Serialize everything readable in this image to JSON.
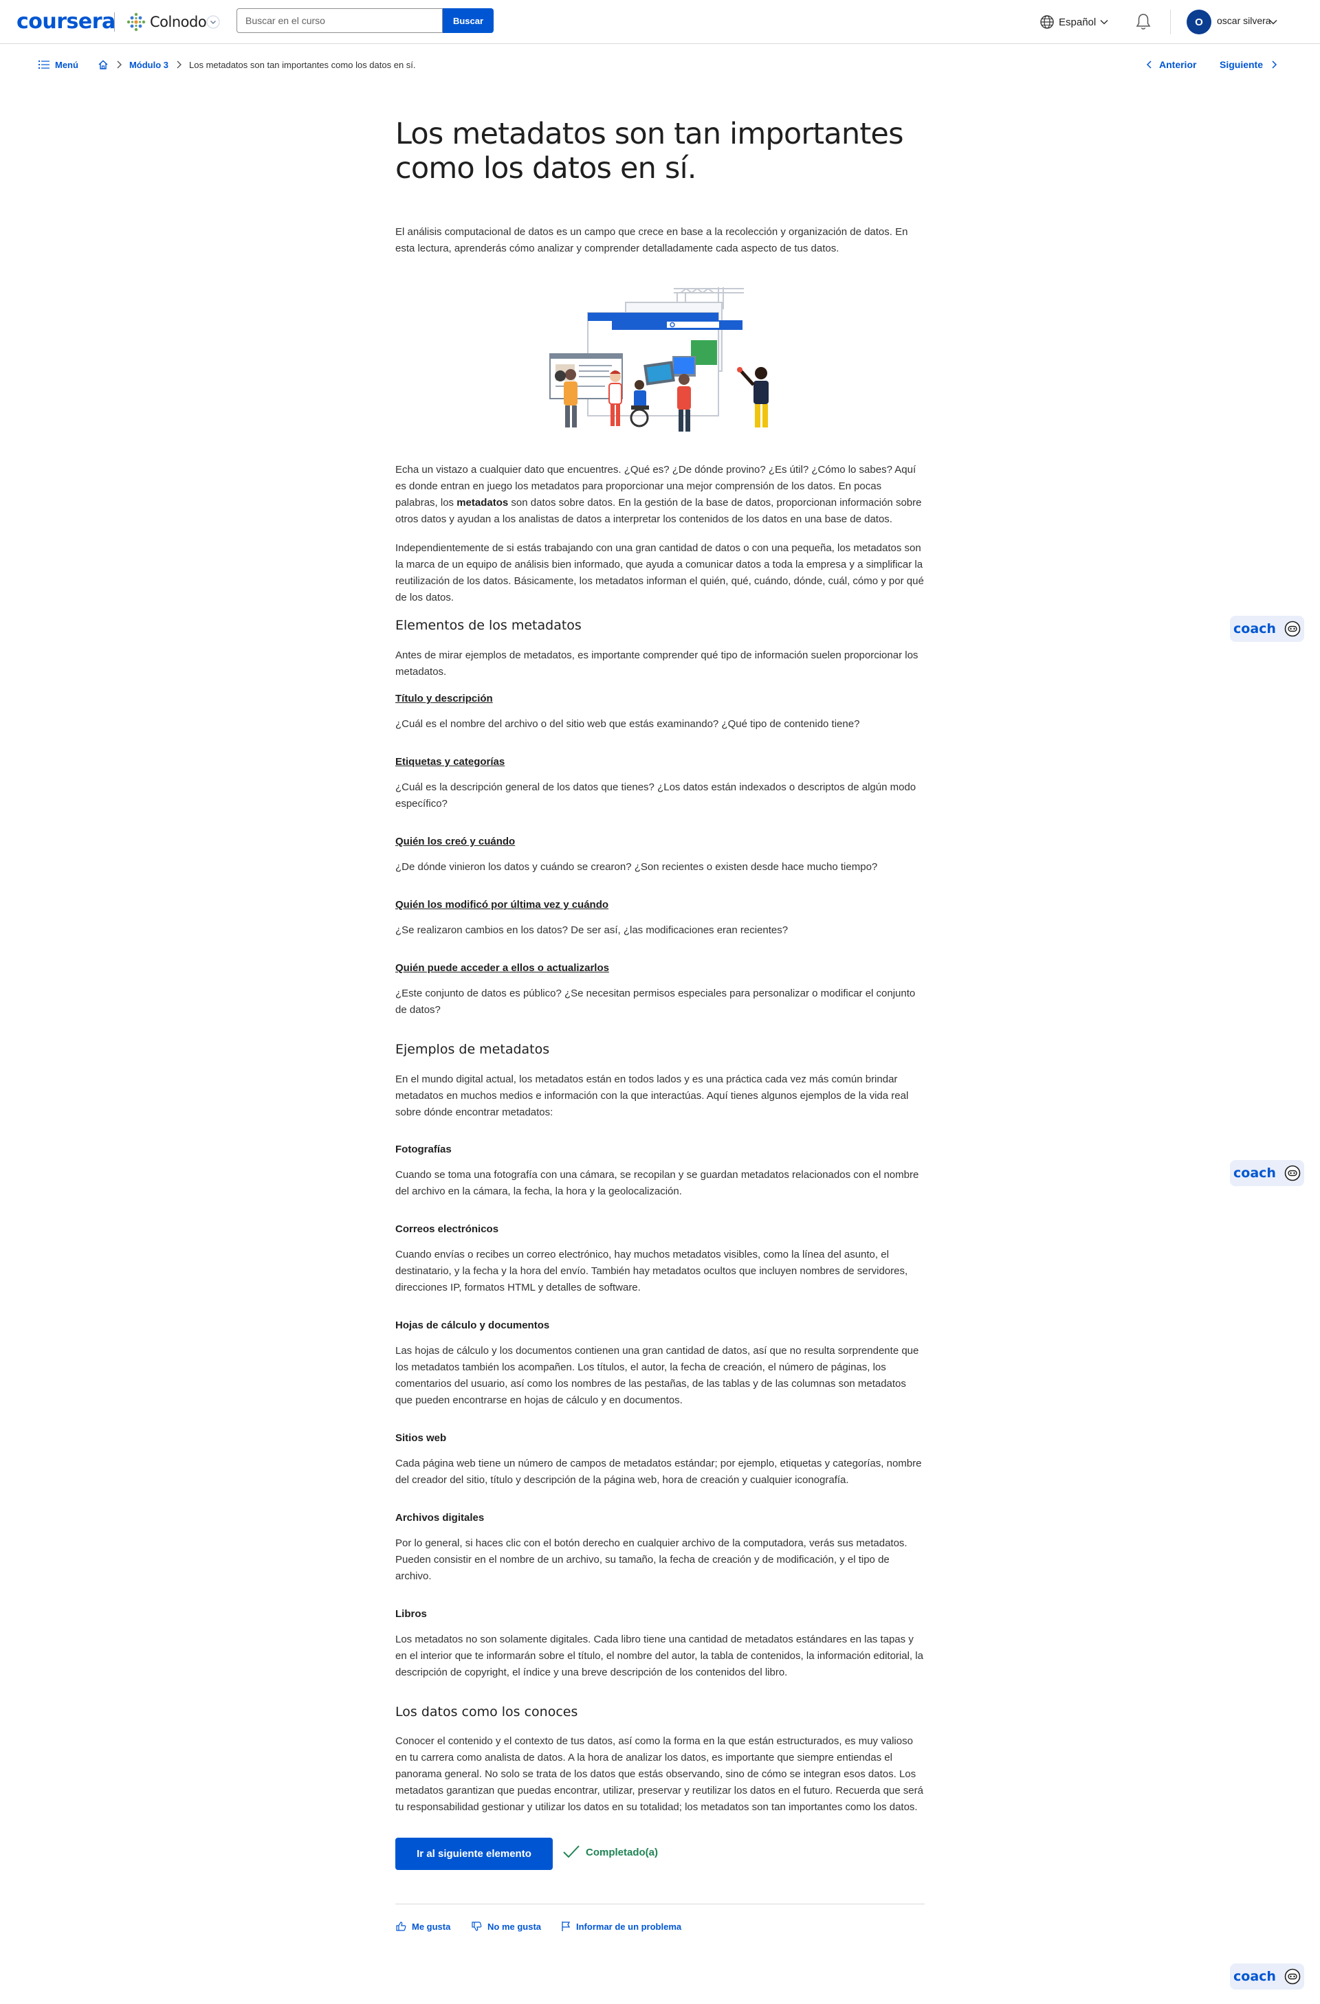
{
  "header": {
    "logo": "coursera",
    "partner": "Colnodo",
    "search_placeholder": "Buscar en el curso",
    "search_button": "Buscar",
    "language": "Español",
    "avatar_initial": "O",
    "username": "oscar silvera"
  },
  "breadcrumb": {
    "menu": "Menú",
    "module": "Módulo 3",
    "current": "Los metadatos son tan importantes como los datos en sí."
  },
  "nav": {
    "previous": "Anterior",
    "next": "Siguiente"
  },
  "article": {
    "title": "Los metadatos son tan importantes como los datos en sí.",
    "intro": "El análisis computacional de datos es un campo que crece en base a la recolección y organización de datos. En esta lectura, aprenderás cómo analizar y comprender detalladamente cada aspecto de tus datos.",
    "p1_before": "Echa un vistazo a cualquier dato que encuentres. ¿Qué es? ¿De dónde provino? ¿Es útil? ¿Cómo lo sabes? Aquí es donde entran en juego los metadatos para proporcionar una mejor comprensión de los datos. En pocas palabras, los ",
    "p1_bold": "metadatos",
    "p1_after": " son datos sobre datos. En la gestión de la base de datos, proporcionan información sobre otros datos y ayudan a los analistas de datos a interpretar los contenidos de los datos en una base de datos.",
    "p2": "Independientemente de si estás trabajando con una gran cantidad de datos o con una pequeña, los metadatos son la marca de un equipo de análisis bien informado, que ayuda a comunicar datos a toda la empresa y a simplificar la reutilización de los datos. Básicamente, los metadatos informan el quién, qué, cuándo, dónde, cuál, cómo y por qué de los datos.",
    "h_elements": "Elementos de los metadatos",
    "elements_intro": "Antes de mirar ejemplos de metadatos, es importante comprender qué tipo de información suelen proporcionar los metadatos.",
    "el1_title": "Título y descripción",
    "el1_text": "¿Cuál es el nombre del archivo o del sitio web que estás examinando? ¿Qué tipo de contenido tiene?",
    "el2_title": "Etiquetas y categorías",
    "el2_text": "¿Cuál es la descripción general de los datos que tienes? ¿Los datos están indexados o descriptos de algún modo específico?",
    "el3_title": "Quién los creó y cuándo",
    "el3_text": "¿De dónde vinieron los datos y cuándo se crearon? ¿Son recientes o existen desde hace mucho tiempo?",
    "el4_title": "Quién los modificó por última vez y cuándo",
    "el4_text": "¿Se realizaron cambios en los datos?  De ser así, ¿las modificaciones eran recientes?",
    "el5_title": "Quién puede acceder a ellos o actualizarlos",
    "el5_text": "¿Este conjunto de datos es público? ¿Se necesitan permisos especiales para personalizar o modificar el conjunto de datos?",
    "h_examples": "Ejemplos de metadatos",
    "examples_intro": "En el mundo digital actual, los metadatos están en todos lados y es una práctica cada vez más común brindar metadatos en muchos medios e información con la que interactúas. Aquí tienes algunos ejemplos de la vida real sobre dónde encontrar metadatos:",
    "ex1_title": "Fotografías",
    "ex1_text": "Cuando se toma una fotografía con una cámara, se recopilan y se guardan metadatos relacionados con el nombre del archivo en la cámara, la fecha, la hora y la geolocalización.",
    "ex2_title": "Correos electrónicos",
    "ex2_text": "Cuando envías o recibes un correo electrónico, hay muchos metadatos visibles, como la línea del asunto, el destinatario, y la fecha y la hora del envío. También hay metadatos ocultos que incluyen nombres de servidores, direcciones IP, formatos HTML y detalles de software.",
    "ex3_title": "Hojas de cálculo y documentos",
    "ex3_text": "Las hojas de cálculo y los documentos contienen una gran cantidad de datos, así que no resulta sorprendente que los metadatos también los acompañen. Los títulos, el autor, la fecha de creación, el número de páginas, los comentarios del usuario, así como los nombres de las pestañas, de las tablas y de las columnas son metadatos que pueden encontrarse en hojas de cálculo y en documentos.",
    "ex4_title": "Sitios web",
    "ex4_text": "Cada página web tiene un número de campos de metadatos estándar; por ejemplo, etiquetas y categorías, nombre del creador del sitio, título y descripción de la página web, hora de creación y cualquier iconografía.",
    "ex5_title": "Archivos digitales",
    "ex5_text": "Por lo general, si haces clic con el botón derecho en cualquier archivo de la computadora, verás sus metadatos. Pueden consistir en el nombre de un archivo, su tamaño, la fecha de creación y de modificación, y el tipo de archivo.",
    "ex6_title": "Libros",
    "ex6_text": "Los metadatos no son solamente digitales. Cada libro tiene una cantidad de metadatos estándares en las tapas y en el interior que te informarán sobre el título, el nombre del autor, la tabla de contenidos, la información editorial, la descripción de copyright, el índice y una breve descripción de los contenidos del libro.",
    "h_known": "Los datos como los conoces",
    "known_text": "Conocer el contenido y el contexto de tus datos, así como la forma en la que están estructurados, es muy valioso en tu carrera como analista de datos. A la hora de analizar los datos, es importante que siempre entiendas el panorama general. No solo se trata de los datos que estás observando, sino de cómo se integran esos datos. Los metadatos garantizan que puedas encontrar, utilizar, preservar y reutilizar los datos en el futuro. Recuerda que será tu responsabilidad gestionar y utilizar los datos en su totalidad; los metadatos son tan importantes como los datos."
  },
  "actions": {
    "next_item": "Ir al siguiente elemento",
    "completed": "Completado(a)",
    "like": "Me gusta",
    "dislike": "No me gusta",
    "report": "Informar de un problema"
  },
  "coach": {
    "label": "coach"
  },
  "colors": {
    "accent": "#0056d2",
    "success": "#1f8354",
    "coach_bg": "#e9eefa"
  }
}
